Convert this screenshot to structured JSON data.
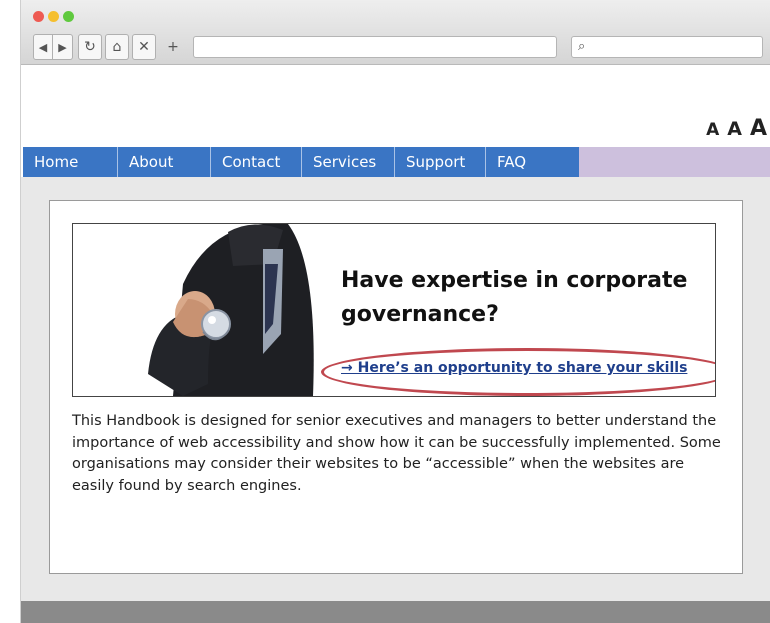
{
  "browser": {
    "toolbar": {
      "back_icon": "◀",
      "forward_icon": "▶",
      "reload_icon": "↻",
      "home_icon": "⌂",
      "stop_icon": "✕",
      "new_tab_icon": "+",
      "address_value": "",
      "search_icon": "⌕",
      "search_value": ""
    }
  },
  "site": {
    "text_size": {
      "small": "A",
      "medium": "A",
      "large": "A"
    },
    "nav": [
      {
        "label": "Home"
      },
      {
        "label": "About"
      },
      {
        "label": "Contact"
      },
      {
        "label": "Services"
      },
      {
        "label": "Support"
      },
      {
        "label": "FAQ"
      }
    ],
    "hero": {
      "headline": "Have expertise in corporate governance?",
      "cta": "→ Here’s an opportunity to share your skills"
    },
    "body": "This Handbook is designed for senior executives and managers to better understand the importance of web accessibility and show how it can be successfully implemented. Some organisations may consider their websites to be “accessible” when the websites are easily found by search engines."
  },
  "colors": {
    "nav_blue": "#3a75c4",
    "nav_accent": "#cdc0dd",
    "highlight_ring": "#c0484f",
    "link": "#1f3f8c"
  }
}
